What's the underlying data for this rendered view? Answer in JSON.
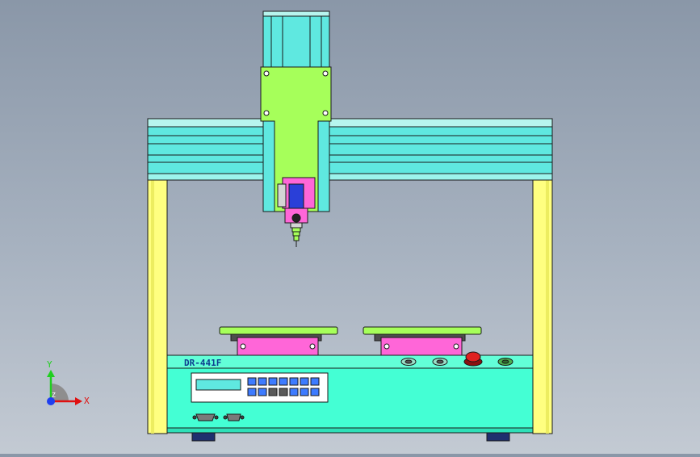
{
  "model_plate": "DR-441F",
  "axis_triad": {
    "x_label": "X",
    "y_label": "Y",
    "z_label": "Z"
  },
  "colors": {
    "frame_yellow": "#ffff80",
    "rail_cyan": "#5fe8e0",
    "carriage_green": "#a6ff5a",
    "base_mint": "#44ffd4",
    "clamp_magenta": "#ff66d8",
    "keypad_blue": "#3d7bff",
    "estop_red": "#e02020",
    "background": "#a7b2c0"
  },
  "icons": {
    "triad": "xyz-axis-triad-icon",
    "estop": "emergency-stop-icon",
    "connector": "db9-connector-icon"
  }
}
